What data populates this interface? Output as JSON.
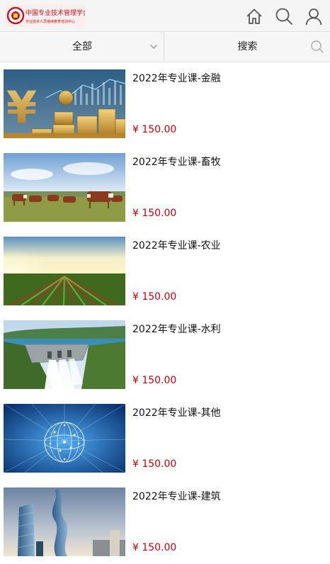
{
  "header": {
    "logo_text_line1": "中国专业技术管理学会",
    "logo_text_line2": "专业技术人员继续教育培训中心",
    "icons": [
      "home-icon",
      "search-icon",
      "user-icon"
    ]
  },
  "filter": {
    "category_selected": "全部",
    "search_label": "搜索"
  },
  "courses": [
    {
      "title": "2022年专业课-金融",
      "price": "¥ 150.00",
      "thumb": "finance-coins"
    },
    {
      "title": "2022年专业课-畜牧",
      "price": "¥ 150.00",
      "thumb": "cattle-pasture"
    },
    {
      "title": "2022年专业课-农业",
      "price": "¥ 150.00",
      "thumb": "crop-field"
    },
    {
      "title": "2022年专业课-水利",
      "price": "¥ 150.00",
      "thumb": "dam-water"
    },
    {
      "title": "2022年专业课-其他",
      "price": "¥ 150.00",
      "thumb": "tech-globe"
    },
    {
      "title": "2022年专业课-建筑",
      "price": "¥ 150.00",
      "thumb": "skyscrapers"
    }
  ],
  "colors": {
    "price": "#c7000b",
    "header_bg": "#f5f5f5",
    "logo_red": "#c8161e"
  }
}
